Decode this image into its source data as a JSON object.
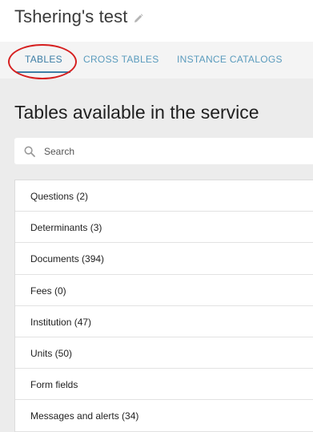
{
  "header": {
    "title": "Tshering's test",
    "edit_icon": "pencil-icon"
  },
  "tabs": [
    {
      "label": "TABLES",
      "active": true
    },
    {
      "label": "CROSS TABLES",
      "active": false
    },
    {
      "label": "INSTANCE CATALOGS",
      "active": false
    }
  ],
  "main": {
    "heading": "Tables available in the service",
    "search": {
      "placeholder": "Search",
      "value": "",
      "icon": "search-icon"
    },
    "tables": [
      {
        "label": "Questions (2)"
      },
      {
        "label": "Determinants (3)"
      },
      {
        "label": "Documents (394)"
      },
      {
        "label": "Fees (0)"
      },
      {
        "label": "Institution (47)"
      },
      {
        "label": "Units (50)"
      },
      {
        "label": "Form fields"
      },
      {
        "label": "Messages and alerts (34)"
      }
    ]
  },
  "colors": {
    "accent": "#3d7ea6",
    "tab_text": "#5a9bbd",
    "annotation": "#d62020",
    "background": "#ececec"
  }
}
